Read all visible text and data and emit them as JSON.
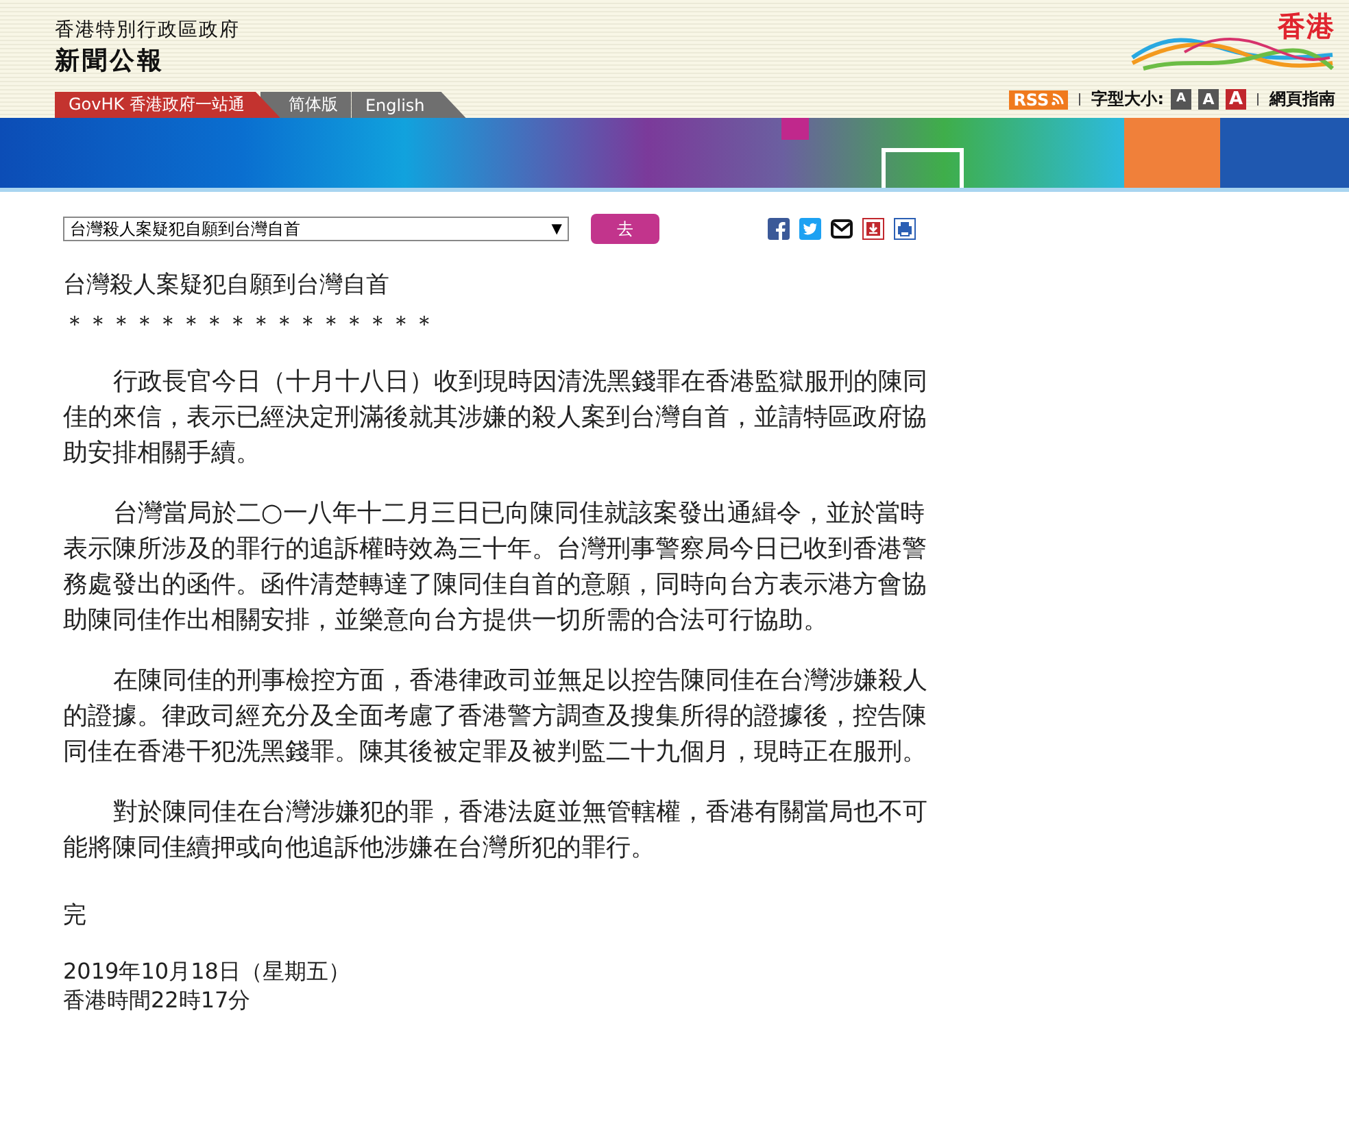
{
  "header": {
    "government": "香港特別行政區政府",
    "title": "新聞公報",
    "logo_text": "香港"
  },
  "nav_tabs": [
    {
      "label": "GovHK 香港政府一站通",
      "kind": "govhk"
    },
    {
      "label": "简体版",
      "kind": "lang"
    },
    {
      "label": "English",
      "kind": "lang"
    }
  ],
  "tools": {
    "rss": "RSS",
    "font_size_label": "字型大小:",
    "font_sizes": [
      {
        "label": "A",
        "selected": false
      },
      {
        "label": "A",
        "selected": false
      },
      {
        "label": "A",
        "selected": true
      }
    ],
    "guide": "網頁指南"
  },
  "selector": {
    "value": "台灣殺人案疑犯自願到台灣自首",
    "arrow": "▼",
    "go_button": "去"
  },
  "share_icons": [
    {
      "kind": "facebook"
    },
    {
      "kind": "twitter"
    },
    {
      "kind": "email"
    },
    {
      "kind": "download"
    },
    {
      "kind": "print"
    }
  ],
  "article": {
    "title": "台灣殺人案疑犯自願到台灣自首",
    "stars": "＊＊＊＊＊＊＊＊＊＊＊＊＊＊＊＊",
    "paragraphs": [
      "行政長官今日（十月十八日）收到現時因清洗黑錢罪在香港監獄服刑的陳同佳的來信，表示已經決定刑滿後就其涉嫌的殺人案到台灣自首，並請特區政府協助安排相關手續。",
      "台灣當局於二○一八年十二月三日已向陳同佳就該案發出通緝令，並於當時表示陳所涉及的罪行的追訴權時效為三十年。台灣刑事警察局今日已收到香港警務處發出的函件。函件清楚轉達了陳同佳自首的意願，同時向台方表示港方會協助陳同佳作出相關安排，並樂意向台方提供一切所需的合法可行協助。",
      "在陳同佳的刑事檢控方面，香港律政司並無足以控告陳同佳在台灣涉嫌殺人的證據。律政司經充分及全面考慮了香港警方調查及搜集所得的證據後，控告陳同佳在香港干犯洗黑錢罪。陳其後被定罪及被判監二十九個月，現時正在服刑。",
      "對於陳同佳在台灣涉嫌犯的罪，香港法庭並無管轄權，香港有關當局也不可能將陳同佳續押或向他追訴他涉嫌在台灣所犯的罪行。"
    ],
    "end": "完",
    "date": "2019年10月18日（星期五）",
    "time": "香港時間22時17分"
  }
}
